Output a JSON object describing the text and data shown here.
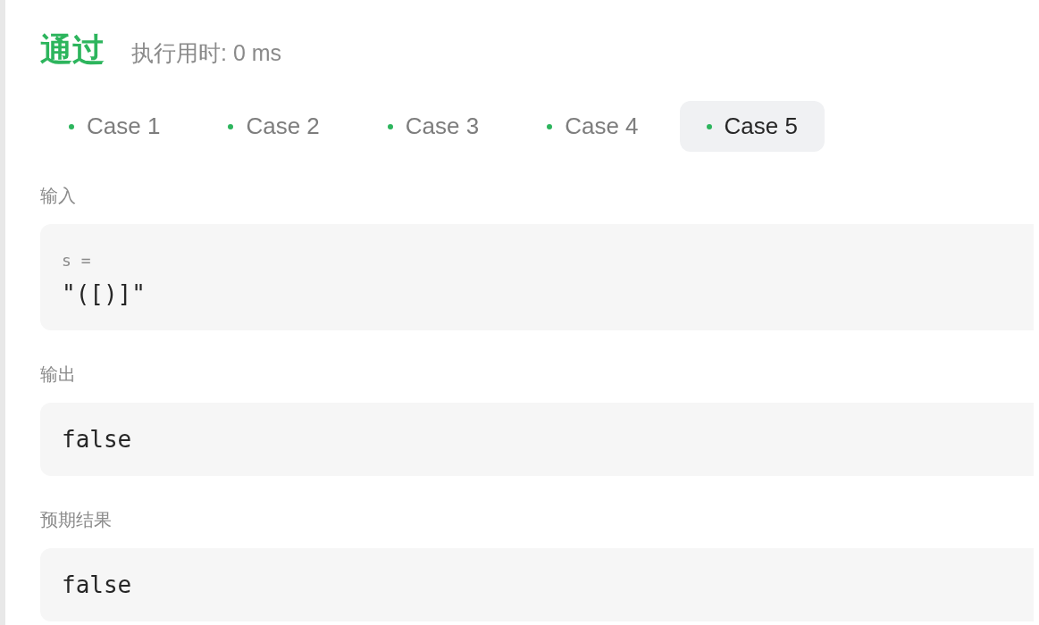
{
  "result": {
    "status": "通过",
    "kind": "accepted",
    "runtime": "执行用时: 0 ms"
  },
  "cases": [
    {
      "label": "Case 1",
      "passed": true,
      "selected": false
    },
    {
      "label": "Case 2",
      "passed": true,
      "selected": false
    },
    {
      "label": "Case 3",
      "passed": true,
      "selected": false
    },
    {
      "label": "Case 4",
      "passed": true,
      "selected": false
    },
    {
      "label": "Case 5",
      "passed": true,
      "selected": true
    }
  ],
  "sections": [
    {
      "kind": "params",
      "label": "输入",
      "params": [
        {
          "name": "s =",
          "value": "\"([)]\""
        }
      ]
    },
    {
      "kind": "value",
      "label": "输出",
      "value": "false"
    },
    {
      "kind": "value",
      "label": "预期结果",
      "value": "false"
    }
  ]
}
